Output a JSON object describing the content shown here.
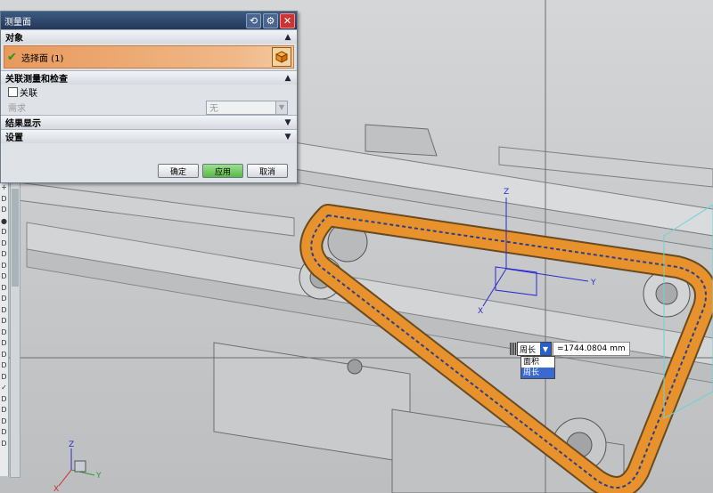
{
  "dialog": {
    "title": "测量面",
    "sections": {
      "object": "对象",
      "assoc": "关联测量和检查",
      "results": "结果显示",
      "settings": "设置"
    },
    "select_face": "选择面 (1)",
    "associate_label": "关联",
    "requirement_label": "需求",
    "requirement_value": "无",
    "buttons": {
      "ok": "确定",
      "apply": "应用",
      "cancel": "取消"
    }
  },
  "measurement": {
    "type_selected": "周长",
    "value": "=1744.0804 mm",
    "options": [
      "面积",
      "周长"
    ],
    "selected_option": "周长"
  },
  "triad_labels": {
    "x": "X",
    "y": "Y",
    "z": "Z"
  },
  "colors": {
    "belt": "#e8922e",
    "titlebar": "#2c4670",
    "selection": "#ef9f60",
    "apply": "#60c050"
  },
  "icons": [
    "restore-icon",
    "gear-icon",
    "close-icon",
    "check-icon",
    "cube-select-icon",
    "chevron-up-icon",
    "chevron-down-icon"
  ]
}
